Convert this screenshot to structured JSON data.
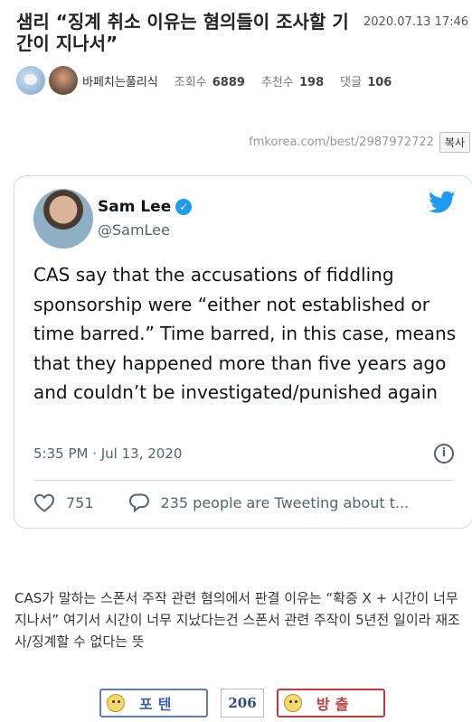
{
  "post": {
    "title": "샘리 “징계 취소 이유는 혐의들이 조사할 기간이 지나서”",
    "date": "2020.07.13 17:46",
    "author": "바페치는풀리식",
    "views_label": "조회수",
    "views": "6889",
    "recommend_label": "추천수",
    "recommend": "198",
    "comments_label": "댓글",
    "comments": "106",
    "url": "fmkorea.com/best/2987972722",
    "copy_label": "복사"
  },
  "tweet": {
    "name": "Sam Lee",
    "handle": "@SamLee",
    "text": "CAS say that the accusations of fiddling sponsorship were “either not established or time barred.” Time barred, in this case, means that they happened more than five years ago and couldn’t be investigated/punished again",
    "time": "5:35 PM · Jul 13, 2020",
    "likes": "751",
    "reply_text": "235 people are Tweeting about t...",
    "info_glyph": "i",
    "verified_glyph": "✓",
    "brand_color": "#1d9bf0"
  },
  "body": {
    "text": "CAS가 말하는 스폰서 주작 관련 혐의에서 판결 이유는 “확증 X + 시간이 너무 지나서” 여기서 시간이 너무 지났다는건 스폰서 관련 주작이 5년전 일이라 재조사/징계할 수 없다는 뜻"
  },
  "vote": {
    "up_label": "포텐",
    "count": "206",
    "down_label": "방출"
  }
}
